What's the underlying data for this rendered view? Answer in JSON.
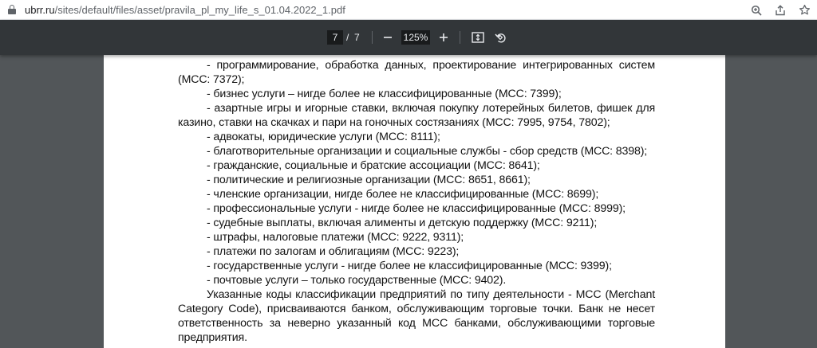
{
  "browser": {
    "url_host": "ubrr.ru",
    "url_path": "/sites/default/files/asset/pravila_pl_my_life_s_01.04.2022_1.pdf",
    "icons": [
      "lock-icon",
      "zoom-icon",
      "share-icon",
      "star-icon"
    ]
  },
  "viewer": {
    "current_page": "7",
    "page_separator": "/",
    "total_pages": "7",
    "zoom": "125%",
    "icons": [
      "zoom-out-icon",
      "zoom-in-icon",
      "fit-page-icon",
      "rotate-icon"
    ]
  },
  "document": {
    "paragraphs": [
      "- программирование, обработка данных, проектирование интегрированных систем (MCC: 7372);",
      "- бизнес услуги – нигде более не классифицированные  (MCC: 7399);",
      "- азартные игры и игорные ставки, включая покупку лотерейных билетов, фишек для казино, ставки на скачках и пари на гоночных состязаниях (MCC: 7995, 9754, 7802);",
      "- адвокаты, юридические услуги (MCC: 8111);",
      "- благотворительные организации и социальные службы - сбор средств (MCC: 8398);",
      "- гражданские, социальные и братские ассоциации (MCC: 8641);",
      "- политические и религиозные организации (MCC: 8651, 8661);",
      "- членские организации, нигде более не классифицированные (MCC: 8699);",
      "- профессиональные услуги - нигде более не классифицированные (MCC: 8999);",
      "- судебные выплаты, включая алименты и детскую поддержку (MCC: 9211);",
      "- штрафы, налоговые платежи (MCC: 9222, 9311);",
      "- платежи по залогам и облигациям (MCC: 9223);",
      "- государственные услуги - нигде более не классифицированные (MCC: 9399);",
      "- почтовые услуги – только государственные (MCC: 9402).",
      "Указанные коды классификации предприятий по типу деятельности - MCC (Merchant Category Code), присваиваются банком, обслуживающим торговые точки. Банк не несет ответственность за неверно указанный код MCC банками, обслуживающими торговые предприятия."
    ]
  }
}
